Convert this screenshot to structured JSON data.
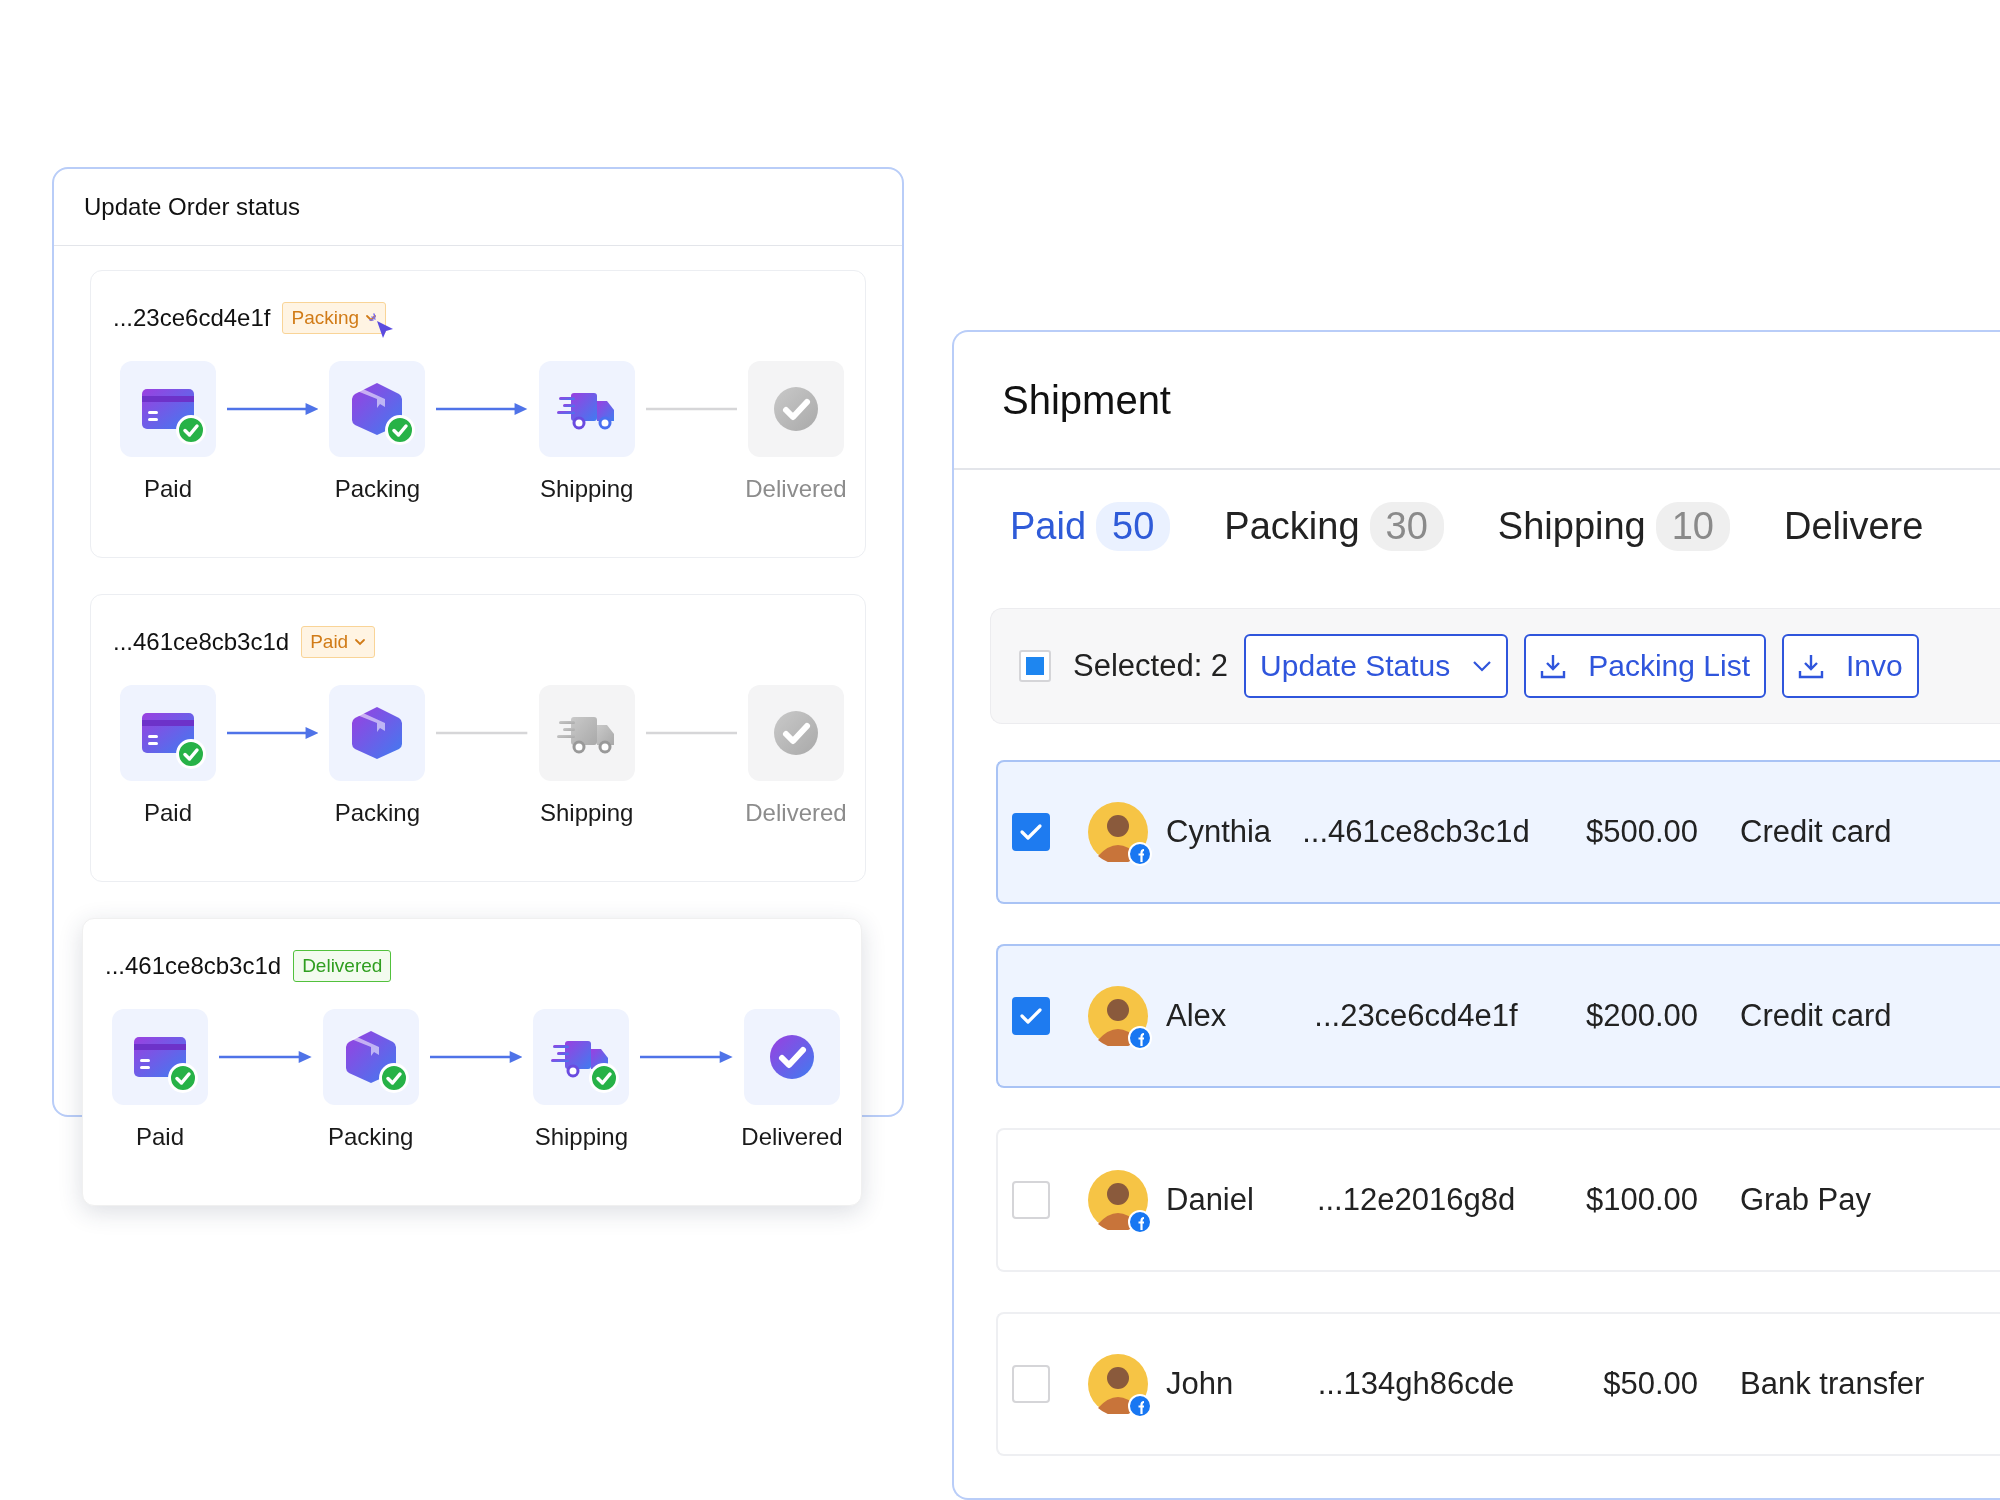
{
  "order_panel": {
    "title": "Update Order status",
    "orders": [
      {
        "order_id": "...23ce6cd4e1f",
        "status": {
          "text": "Packing",
          "complete": false,
          "dropdown": true
        },
        "pointer": true,
        "raised": false,
        "steps": [
          {
            "label": "Paid",
            "kind": "card",
            "reached": true,
            "done": true,
            "dimmed": false
          },
          {
            "label": "Packing",
            "kind": "box",
            "reached": true,
            "done": true,
            "dimmed": false
          },
          {
            "label": "Shipping",
            "kind": "truck",
            "reached": true,
            "done": false,
            "dimmed": false
          },
          {
            "label": "Delivered",
            "kind": "check",
            "reached": false,
            "done": false,
            "dimmed": true
          }
        ]
      },
      {
        "order_id": "...461ce8cb3c1d",
        "status": {
          "text": "Paid",
          "complete": false,
          "dropdown": true
        },
        "pointer": false,
        "raised": false,
        "steps": [
          {
            "label": "Paid",
            "kind": "card",
            "reached": true,
            "done": true,
            "dimmed": false
          },
          {
            "label": "Packing",
            "kind": "box",
            "reached": true,
            "done": false,
            "dimmed": false
          },
          {
            "label": "Shipping",
            "kind": "truck",
            "reached": false,
            "done": false,
            "dimmed": false
          },
          {
            "label": "Delivered",
            "kind": "check",
            "reached": false,
            "done": false,
            "dimmed": true
          }
        ]
      },
      {
        "order_id": "...461ce8cb3c1d",
        "status": {
          "text": "Delivered",
          "complete": true,
          "dropdown": false
        },
        "pointer": false,
        "raised": true,
        "steps": [
          {
            "label": "Paid",
            "kind": "card",
            "reached": true,
            "done": true,
            "dimmed": false
          },
          {
            "label": "Packing",
            "kind": "box",
            "reached": true,
            "done": true,
            "dimmed": false
          },
          {
            "label": "Shipping",
            "kind": "truck",
            "reached": true,
            "done": true,
            "dimmed": false
          },
          {
            "label": "Delivered",
            "kind": "check",
            "reached": true,
            "done": true,
            "dimmed": false
          }
        ]
      }
    ]
  },
  "shipment": {
    "title": "Shipment",
    "tabs": [
      {
        "label": "Paid",
        "count": "50",
        "selected": true
      },
      {
        "label": "Packing",
        "count": "30",
        "selected": false
      },
      {
        "label": "Shipping",
        "count": "10",
        "selected": false
      },
      {
        "label": "Delivere",
        "selected": false
      }
    ],
    "toolbar": {
      "select_all_partial": true,
      "selected_text": "Selected: 2",
      "buttons": [
        {
          "label": "Update Status",
          "kind": "dropdown"
        },
        {
          "label": "Packing List",
          "kind": "download"
        },
        {
          "label": "Invo",
          "kind": "download"
        }
      ]
    },
    "rows": [
      {
        "checked": true,
        "name": "Cynthia",
        "order_id": "...461ce8cb3c1d",
        "amount": "$500.00",
        "method": "Credit card"
      },
      {
        "checked": true,
        "name": "Alex",
        "order_id": "...23ce6cd4e1f",
        "amount": "$200.00",
        "method": "Credit card"
      },
      {
        "checked": false,
        "name": "Daniel",
        "order_id": "...12e2016g8d",
        "amount": "$100.00",
        "method": "Grab Pay"
      },
      {
        "checked": false,
        "name": "John",
        "order_id": "...134gh86cde",
        "amount": "$50.00",
        "method": "Bank transfer"
      }
    ]
  }
}
